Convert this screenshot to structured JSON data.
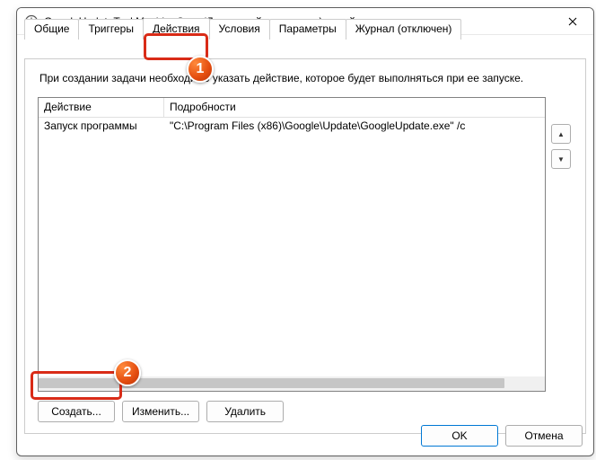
{
  "window": {
    "title": "GoogleUpdateTaskMachineCore (Локальный компьютер) - свойства"
  },
  "tabs": {
    "items": [
      {
        "label": "Общие"
      },
      {
        "label": "Триггеры"
      },
      {
        "label": "Действия"
      },
      {
        "label": "Условия"
      },
      {
        "label": "Параметры"
      },
      {
        "label": "Журнал (отключен)"
      }
    ],
    "activeIndex": 2
  },
  "content": {
    "description": "При создании задачи необходимо указать действие, которое будет выполняться при ее запуске."
  },
  "list": {
    "headers": {
      "col1": "Действие",
      "col2": "Подробности"
    },
    "rows": [
      {
        "col1": "Запуск программы",
        "col2": "\"C:\\Program Files (x86)\\Google\\Update\\GoogleUpdate.exe\" /c"
      }
    ]
  },
  "actions": {
    "create": "Создать...",
    "edit": "Изменить...",
    "delete": "Удалить"
  },
  "dialog": {
    "ok": "OK",
    "cancel": "Отмена"
  },
  "badges": {
    "b1": "1",
    "b2": "2"
  }
}
